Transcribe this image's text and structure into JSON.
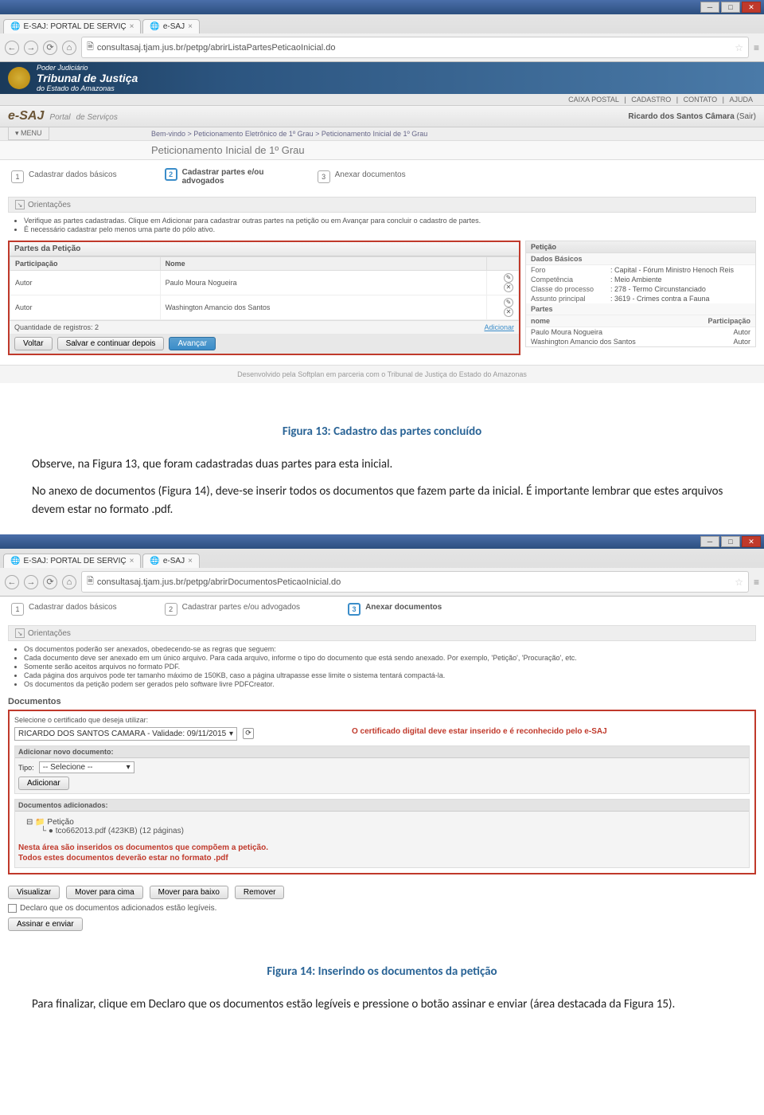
{
  "browser": {
    "tab1": "E-SAJ: PORTAL DE SERVIÇ",
    "tab2": "e-SAJ",
    "url1": "consultasaj.tjam.jus.br/petpg/abrirListaPartesPeticaoInicial.do",
    "url2": "consultasaj.tjam.jus.br/petpg/abrirDocumentosPeticaoInicial.do"
  },
  "banner": {
    "super": "Poder Judiciário",
    "title": "Tribunal de Justiça",
    "sub": "do Estado do Amazonas"
  },
  "toplinks": {
    "a": "CAIXA POSTAL",
    "b": "CADASTRO",
    "c": "CONTATO",
    "d": "AJUDA"
  },
  "esaj": {
    "logo_e": "e-SAJ",
    "portal": "Portal",
    "servicos": "de Serviços",
    "user": "Ricardo dos Santos Câmara",
    "logout": "(Sair)"
  },
  "breadcrumb": "Bem-vindo > Peticionamento Eletrônico de 1º Grau > Peticionamento Inicial de 1º Grau",
  "page_title": "Peticionamento Inicial de 1º Grau",
  "menu": "MENU",
  "steps": {
    "s1": "Cadastrar dados básicos",
    "s2": "Cadastrar partes e/ou advogados",
    "s2b": "Cadastrar partes e/ou advogados",
    "s3": "Anexar documentos"
  },
  "orient_hdr": "Orientações",
  "tips": {
    "t1": "Verifique as partes cadastradas. Clique em Adicionar para cadastrar outras partes na petição ou em Avançar para concluir o cadastro de partes.",
    "t2": "É necessário cadastrar pelo menos uma parte do pólo ativo."
  },
  "partes": {
    "hdr": "Partes da Petição",
    "col1": "Participação",
    "col2": "Nome",
    "r1c1": "Autor",
    "r1c2": "Paulo Moura Nogueira",
    "r2c1": "Autor",
    "r2c2": "Washington Amancio dos Santos",
    "count": "Quantidade de registros: 2",
    "add": "Adicionar"
  },
  "buttons": {
    "voltar": "Voltar",
    "salvar": "Salvar e continuar depois",
    "avancar": "Avançar",
    "adicionar": "Adicionar",
    "visualizar": "Visualizar",
    "cima": "Mover para cima",
    "baixo": "Mover para baixo",
    "remover": "Remover",
    "assinar": "Assinar e enviar"
  },
  "right": {
    "peticao": "Petição",
    "dados": "Dados Básicos",
    "foro_k": "Foro",
    "foro_v": ": Capital - Fórum Ministro Henoch Reis",
    "comp_k": "Competência",
    "comp_v": ": Meio Ambiente",
    "classe_k": "Classe do processo",
    "classe_v": ": 278 - Termo Circunstanciado",
    "assunto_k": "Assunto principal",
    "assunto_v": ": 3619 - Crimes contra a Fauna",
    "partes_hdr": "Partes",
    "nome": "nome",
    "participacao": "Participação",
    "p1": "Paulo Moura Nogueira",
    "p1r": "Autor",
    "p2": "Washington Amancio dos Santos",
    "p2r": "Autor"
  },
  "footer": "Desenvolvido pela Softplan em parceria com o Tribunal de Justiça do Estado do Amazonas",
  "doc": {
    "fig13": "Figura 13: Cadastro das partes concluído",
    "p1": "Observe, na Figura 13, que foram cadastradas duas partes para esta inicial.",
    "p2": "No anexo de documentos (Figura 14), deve-se inserir todos os documentos que fazem parte da inicial. É importante lembrar que estes arquivos devem estar no formato .pdf.",
    "fig14": "Figura 14: Inserindo os documentos da petição",
    "p3": "Para finalizar, clique em Declaro que os documentos estão legíveis e pressione o botão assinar e enviar (área destacada da Figura 15)."
  },
  "shot2": {
    "tips": {
      "t1": "Os documentos poderão ser anexados, obedecendo-se as regras que seguem:",
      "t2": "Cada documento deve ser anexado em um único arquivo. Para cada arquivo, informe o tipo do documento que está sendo anexado. Por exemplo, 'Petição', 'Procuração', etc.",
      "t3": "Somente serão aceitos arquivos no formato PDF.",
      "t4": "Cada página dos arquivos pode ter tamanho máximo de 150KB, caso a página ultrapasse esse limite o sistema tentará compactá-la.",
      "t5": "Os documentos da petição podem ser gerados pelo software livre PDFCreator."
    },
    "docs_hdr": "Documentos",
    "cert_label": "Selecione o certificado que deseja utilizar:",
    "cert_value": "RICARDO DOS SANTOS CAMARA - Validade: 09/11/2015",
    "cert_note": "O certificado digital deve estar inserido e é reconhecido pelo e-SAJ",
    "add_hdr": "Adicionar novo documento:",
    "tipo": "Tipo:",
    "tipo_val": "-- Selecione --",
    "added_hdr": "Documentos adicionados:",
    "folder": "Petição",
    "file": "tco662013.pdf (423KB) (12 páginas)",
    "red1": "Nesta área são inseridos os documentos que compõem a petição.",
    "red2": "Todos estes documentos deverão estar no formato .pdf",
    "declare": "Declaro que os documentos adicionados estão legíveis."
  }
}
